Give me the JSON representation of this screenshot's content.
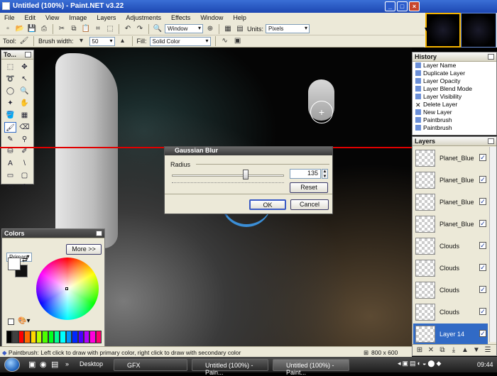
{
  "window": {
    "title": "Untitled (100%) - Paint.NET v3.22"
  },
  "menu": [
    "File",
    "Edit",
    "View",
    "Image",
    "Layers",
    "Adjustments",
    "Effects",
    "Window",
    "Help"
  ],
  "toolbar": {
    "zoom_label": "Window",
    "units_label": "Units:",
    "units_value": "Pixels"
  },
  "toolbar2": {
    "tool_label": "Tool:",
    "brush_label": "Brush width:",
    "brush_value": "50",
    "fill_label": "Fill:",
    "fill_value": "Solid Color"
  },
  "tools_panel": {
    "title": "To..."
  },
  "colors_panel": {
    "title": "Colors",
    "mode": "Primary",
    "more_button": "More >>"
  },
  "history_panel": {
    "title": "History",
    "items": [
      "Layer Name",
      "Duplicate Layer",
      "Layer Opacity",
      "Layer Blend Mode",
      "Layer Visibility",
      "Delete Layer",
      "New Layer",
      "Paintbrush",
      "Paintbrush"
    ]
  },
  "layers_panel": {
    "title": "Layers",
    "items": [
      {
        "name": "Planet_Blue",
        "visible": true,
        "selected": false
      },
      {
        "name": "Planet_Blue",
        "visible": true,
        "selected": false
      },
      {
        "name": "Planet_Blue",
        "visible": true,
        "selected": false
      },
      {
        "name": "Planet_Blue",
        "visible": true,
        "selected": false
      },
      {
        "name": "Clouds",
        "visible": true,
        "selected": false
      },
      {
        "name": "Clouds",
        "visible": true,
        "selected": false
      },
      {
        "name": "Clouds",
        "visible": true,
        "selected": false
      },
      {
        "name": "Clouds",
        "visible": true,
        "selected": false
      },
      {
        "name": "Layer 14",
        "visible": true,
        "selected": true
      }
    ]
  },
  "dialog": {
    "title": "Gaussian Blur",
    "radius_label": "Radius",
    "radius_value": "135",
    "reset_button": "Reset",
    "ok_button": "OK",
    "cancel_button": "Cancel"
  },
  "statusbar": {
    "hint": "Paintbrush: Left click to draw with primary color, right click to draw with secondary color",
    "size": "800 x 600"
  },
  "taskbar": {
    "items": [
      "Desktop",
      "GFX",
      "Untitled (100%) - Pain...",
      "Untitled (100%) - Paint..."
    ],
    "time": "09:44"
  },
  "palette_colors": [
    "#000000",
    "#404040",
    "#ff0000",
    "#ff6a00",
    "#ffd800",
    "#b6ff00",
    "#4cff00",
    "#00ff21",
    "#00ff90",
    "#00ffff",
    "#0094ff",
    "#0026ff",
    "#4800ff",
    "#b200ff",
    "#ff00dc",
    "#ff006e"
  ]
}
